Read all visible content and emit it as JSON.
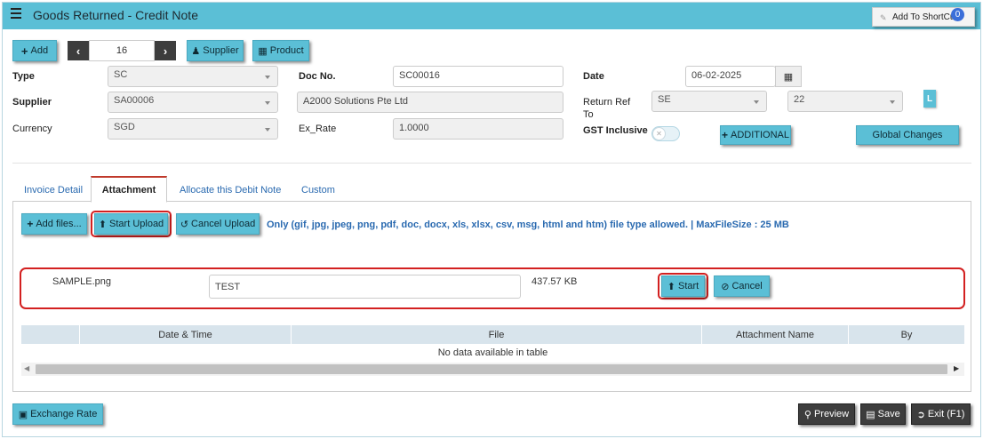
{
  "window": {
    "title": "Goods Returned - Credit Note"
  },
  "shortcut": {
    "label": "Add To ShortCut",
    "badge": "0"
  },
  "toolbar": {
    "add_label": "Add",
    "record_number": "16",
    "supplier_label": "Supplier",
    "product_label": "Product"
  },
  "form": {
    "type_label": "Type",
    "type_value": "SC",
    "docno_label": "Doc No.",
    "docno_value": "SC00016",
    "date_label": "Date",
    "date_value": "06-02-2025",
    "supplier_label": "Supplier",
    "supplier_code": "SA00006",
    "supplier_name": "A2000 Solutions Pte Ltd",
    "returnref_label_1": "Return Ref",
    "returnref_label_2": "To",
    "returnref_value": "SE",
    "returnref_value2": "22",
    "l_badge": "L",
    "currency_label": "Currency",
    "currency_value": "SGD",
    "exrate_label": "Ex_Rate",
    "exrate_value": "1.0000",
    "gst_label": "GST Inclusive",
    "additional_label": "ADDITIONAL",
    "global_changes_label": "Global Changes"
  },
  "tabs": [
    {
      "label": "Invoice Detail"
    },
    {
      "label": "Attachment"
    },
    {
      "label": "Allocate this Debit Note"
    },
    {
      "label": "Custom"
    }
  ],
  "attachment": {
    "add_files_label": "Add files...",
    "start_upload_label": "Start Upload",
    "cancel_upload_label": "Cancel Upload",
    "info_text": "Only (gif, jpg, jpeg, png, pdf, doc, docx, xls, xlsx, csv, msg, html and htm) file type allowed. | MaxFileSize : 25 MB",
    "file": {
      "name": "SAMPLE.png",
      "description": "TEST",
      "size": "437.57 KB",
      "start_label": "Start",
      "cancel_label": "Cancel"
    },
    "table": {
      "columns": [
        "Date & Time",
        "File",
        "Attachment Name",
        "By"
      ],
      "empty_text": "No data available in table"
    }
  },
  "footer": {
    "exchange_rate_label": "Exchange Rate",
    "preview_label": "Preview",
    "save_label": "Save",
    "exit_label": "Exit (F1)"
  },
  "colors": {
    "accent": "#5bbfd6",
    "highlight": "#d32020",
    "link": "#2a6ab0"
  }
}
